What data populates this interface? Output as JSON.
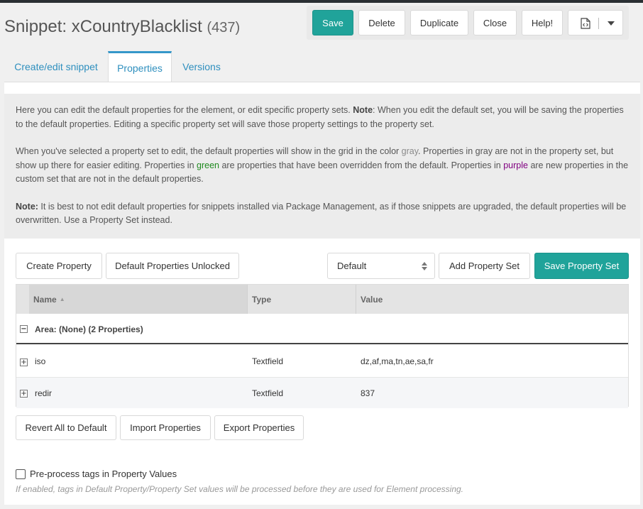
{
  "header": {
    "title": "Snippet: xCountryBlacklist",
    "id": "(437)"
  },
  "toolbar": {
    "save_label": "Save",
    "delete_label": "Delete",
    "duplicate_label": "Duplicate",
    "close_label": "Close",
    "help_label": "Help!",
    "accent_color": "#20a39a"
  },
  "tabs": [
    {
      "label": "Create/edit snippet"
    },
    {
      "label": "Properties"
    },
    {
      "label": "Versions"
    }
  ],
  "info": {
    "p1_note_label": "Note",
    "p1_a": "Here you can edit the default properties for the element, or edit specific property sets. ",
    "p1_b": ": When you edit the default set, you will be saving the properties to the default properties. Editing a specific property set will save those property settings to the property set.",
    "p2_a": "When you've selected a property set to edit, the default properties will show in the grid in the color ",
    "p2_gray": "gray",
    "p2_b": ". Properties in gray are not in the property set, but show up there for easier editing. Properties in ",
    "p2_green": "green",
    "p2_c": " are properties that have been overridden from the default. Properties in ",
    "p2_purple": "purple",
    "p2_d": " are new properties in the custom set that are not in the default properties.",
    "p3_note_label": "Note:",
    "p3_text": " It is best to not edit default properties for snippets installed via Package Management, as if those snippets are upgraded, the default properties will be overwritten. Use a Property Set instead."
  },
  "property_toolbar": {
    "create_property": "Create Property",
    "default_unlocked": "Default Properties Unlocked",
    "property_set_selected": "Default",
    "add_property_set": "Add Property Set",
    "save_property_set": "Save Property Set"
  },
  "grid": {
    "columns": [
      "Name",
      "Type",
      "Value"
    ],
    "sort_indicator": "▲",
    "group_label": "Area: (None) (2 Properties)",
    "rows": [
      {
        "name": "iso",
        "type": "Textfield",
        "value": "dz,af,ma,tn,ae,sa,fr"
      },
      {
        "name": "redir",
        "type": "Textfield",
        "value": "837"
      }
    ]
  },
  "grid_actions": {
    "revert_all": "Revert All to Default",
    "import": "Import Properties",
    "export": "Export Properties"
  },
  "preprocess": {
    "label": "Pre-process tags in Property Values",
    "checked": false,
    "hint": "If enabled, tags in Default Property/Property Set values will be processed before they are used for Element processing."
  }
}
